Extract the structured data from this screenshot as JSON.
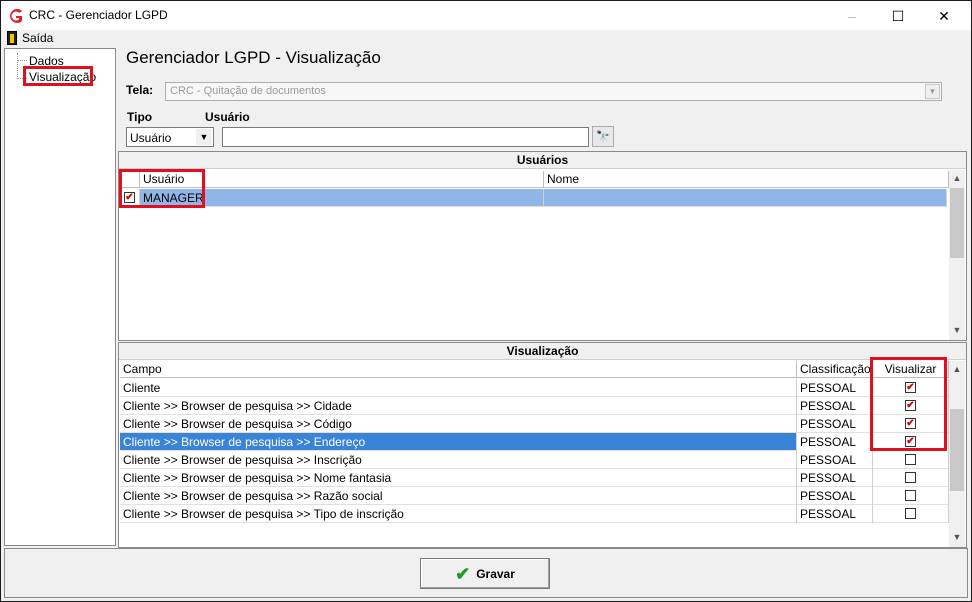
{
  "window": {
    "title": "CRC - Gerenciador LGPD",
    "min": "–",
    "max": "☐",
    "close": "✕"
  },
  "menu": {
    "exit_label": "Saída"
  },
  "tree": {
    "items": [
      "Dados",
      "Visualização"
    ]
  },
  "heading": "Gerenciador LGPD - Visualização",
  "tela": {
    "label": "Tela:",
    "value": "CRC - Quitação de documentos"
  },
  "filters": {
    "tipo_label": "Tipo",
    "usuario_label": "Usuário",
    "tipo_value": "Usuário",
    "usuario_value": ""
  },
  "users_section": {
    "title": "Usuários",
    "columns": [
      "Usuário",
      "Nome"
    ],
    "rows": [
      {
        "checked": true,
        "usuario": "MANAGER",
        "nome": ""
      }
    ]
  },
  "view_section": {
    "title": "Visualização",
    "columns": [
      "Campo",
      "Classificação",
      "Visualizar"
    ],
    "rows": [
      {
        "campo": "Cliente",
        "classificacao": "PESSOAL",
        "visualizar": true
      },
      {
        "campo": "Cliente >> Browser de pesquisa >> Cidade",
        "classificacao": "PESSOAL",
        "visualizar": true
      },
      {
        "campo": "Cliente >> Browser de pesquisa >> Código",
        "classificacao": "PESSOAL",
        "visualizar": true
      },
      {
        "campo": "Cliente >> Browser de pesquisa >> Endereço",
        "classificacao": "PESSOAL",
        "visualizar": true
      },
      {
        "campo": "Cliente >> Browser de pesquisa >> Inscrição",
        "classificacao": "PESSOAL",
        "visualizar": false
      },
      {
        "campo": "Cliente >> Browser de pesquisa >> Nome fantasia",
        "classificacao": "PESSOAL",
        "visualizar": false
      },
      {
        "campo": "Cliente >> Browser de pesquisa >> Razão social",
        "classificacao": "PESSOAL",
        "visualizar": false
      },
      {
        "campo": "Cliente >> Browser de pesquisa >> Tipo de inscrição",
        "classificacao": "PESSOAL",
        "visualizar": false
      }
    ]
  },
  "buttons": {
    "save_label": "Gravar"
  },
  "colors": {
    "highlight": "#e01020",
    "selection": "#3a84d8",
    "check": "#d00000"
  }
}
